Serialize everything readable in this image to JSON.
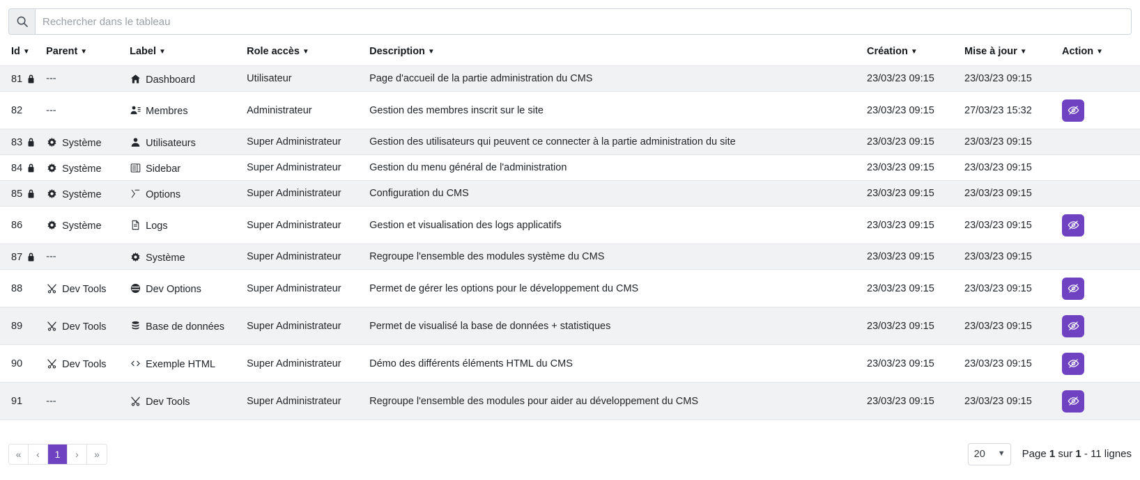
{
  "search": {
    "placeholder": "Rechercher dans le tableau",
    "value": "",
    "icon": "search-icon"
  },
  "table": {
    "columns": [
      {
        "key": "id",
        "label": "Id",
        "caret": "▼"
      },
      {
        "key": "parent",
        "label": "Parent",
        "caret": "▼"
      },
      {
        "key": "label",
        "label": "Label",
        "caret": "▼"
      },
      {
        "key": "role",
        "label": "Role accès",
        "caret": "▼"
      },
      {
        "key": "desc",
        "label": "Description",
        "caret": "▼"
      },
      {
        "key": "crea",
        "label": "Création",
        "caret": "▼"
      },
      {
        "key": "maj",
        "label": "Mise à jour",
        "caret": "▼"
      },
      {
        "key": "action",
        "label": "Action",
        "caret": "▼"
      }
    ],
    "rows": [
      {
        "id": "81",
        "locked": true,
        "striped": true,
        "tall": false,
        "parent": "---",
        "parent_icon": "",
        "label": "Dashboard",
        "label_icon": "home-icon",
        "role": "Utilisateur",
        "desc": "Page d'accueil de la partie administration du CMS",
        "crea": "23/03/23 09:15",
        "maj": "23/03/23 09:15",
        "action": false
      },
      {
        "id": "82",
        "locked": false,
        "striped": false,
        "tall": true,
        "parent": "---",
        "parent_icon": "",
        "label": "Membres",
        "label_icon": "users-group-icon",
        "role": "Administrateur",
        "desc": "Gestion des membres inscrit sur le site",
        "crea": "23/03/23 09:15",
        "maj": "27/03/23 15:32",
        "action": true
      },
      {
        "id": "83",
        "locked": true,
        "striped": true,
        "tall": false,
        "parent": "Système",
        "parent_icon": "gear-icon",
        "label": "Utilisateurs",
        "label_icon": "user-icon",
        "role": "Super Administrateur",
        "desc": "Gestion des utilisateurs qui peuvent ce connecter à la partie administration du site",
        "crea": "23/03/23 09:15",
        "maj": "23/03/23 09:15",
        "action": false
      },
      {
        "id": "84",
        "locked": true,
        "striped": false,
        "tall": false,
        "parent": "Système",
        "parent_icon": "gear-icon",
        "label": "Sidebar",
        "label_icon": "sidebar-icon",
        "role": "Super Administrateur",
        "desc": "Gestion du menu général de l'administration",
        "crea": "23/03/23 09:15",
        "maj": "23/03/23 09:15",
        "action": false
      },
      {
        "id": "85",
        "locked": true,
        "striped": true,
        "tall": false,
        "parent": "Système",
        "parent_icon": "gear-icon",
        "label": "Options",
        "label_icon": "sliders-icon",
        "role": "Super Administrateur",
        "desc": "Configuration du CMS",
        "crea": "23/03/23 09:15",
        "maj": "23/03/23 09:15",
        "action": false
      },
      {
        "id": "86",
        "locked": false,
        "striped": false,
        "tall": true,
        "parent": "Système",
        "parent_icon": "gear-icon",
        "label": "Logs",
        "label_icon": "file-text-icon",
        "role": "Super Administrateur",
        "desc": "Gestion et visualisation des logs applicatifs",
        "crea": "23/03/23 09:15",
        "maj": "23/03/23 09:15",
        "action": true
      },
      {
        "id": "87",
        "locked": true,
        "striped": true,
        "tall": false,
        "parent": "---",
        "parent_icon": "",
        "label": "Système",
        "label_icon": "gear-icon",
        "role": "Super Administrateur",
        "desc": "Regroupe l'ensemble des modules système du CMS",
        "crea": "23/03/23 09:15",
        "maj": "23/03/23 09:15",
        "action": false
      },
      {
        "id": "88",
        "locked": false,
        "striped": false,
        "tall": true,
        "parent": "Dev Tools",
        "parent_icon": "tools-icon",
        "label": "Dev Options",
        "label_icon": "toggles-icon",
        "role": "Super Administrateur",
        "desc": "Permet de gérer les options pour le développement du CMS",
        "crea": "23/03/23 09:15",
        "maj": "23/03/23 09:15",
        "action": true
      },
      {
        "id": "89",
        "locked": false,
        "striped": true,
        "tall": true,
        "parent": "Dev Tools",
        "parent_icon": "tools-icon",
        "label": "Base de données",
        "label_icon": "database-icon",
        "role": "Super Administrateur",
        "desc": "Permet de visualisé la base de données + statistiques",
        "crea": "23/03/23 09:15",
        "maj": "23/03/23 09:15",
        "action": true
      },
      {
        "id": "90",
        "locked": false,
        "striped": false,
        "tall": true,
        "parent": "Dev Tools",
        "parent_icon": "tools-icon",
        "label": "Exemple HTML",
        "label_icon": "code-icon",
        "role": "Super Administrateur",
        "desc": "Démo des différents éléments HTML du CMS",
        "crea": "23/03/23 09:15",
        "maj": "23/03/23 09:15",
        "action": true
      },
      {
        "id": "91",
        "locked": false,
        "striped": true,
        "tall": true,
        "parent": "---",
        "parent_icon": "",
        "label": "Dev Tools",
        "label_icon": "tools-icon",
        "role": "Super Administrateur",
        "desc": "Regroupe l'ensemble des modules pour aider au développement du CMS",
        "crea": "23/03/23 09:15",
        "maj": "23/03/23 09:15",
        "action": true
      }
    ],
    "action_button": {
      "icon": "eye-slash-icon",
      "color": "#6f42c1"
    }
  },
  "pagination": {
    "first_label": "«",
    "prev_label": "‹",
    "next_label": "›",
    "last_label": "»",
    "current_page": "1",
    "per_page_value": "20",
    "per_page_options": [
      "20"
    ],
    "info_prefix": "Page",
    "info_page": "1",
    "info_middle": "sur",
    "info_total_pages": "1",
    "info_suffix": "- 11 lignes"
  }
}
